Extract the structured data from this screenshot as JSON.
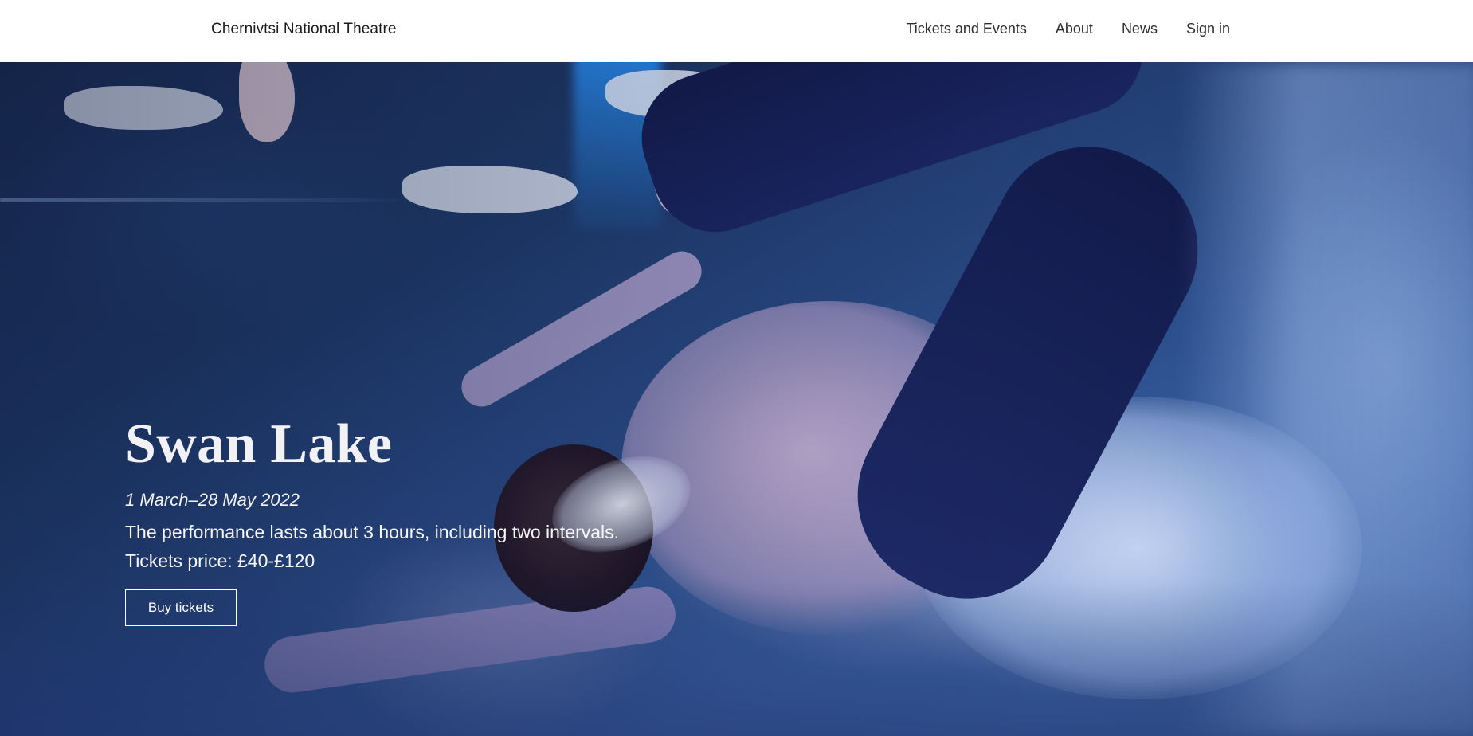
{
  "header": {
    "brand": "Chernivtsi National Theatre",
    "nav": [
      {
        "label": "Tickets and Events"
      },
      {
        "label": "About"
      },
      {
        "label": "News"
      },
      {
        "label": "Sign in"
      }
    ]
  },
  "hero": {
    "title": "Swan Lake",
    "dates": "1 March–28 May 2022",
    "description": "The performance lasts about 3 hours, including two intervals.",
    "price": "Tickets price: £40-£120",
    "cta_label": "Buy tickets"
  }
}
